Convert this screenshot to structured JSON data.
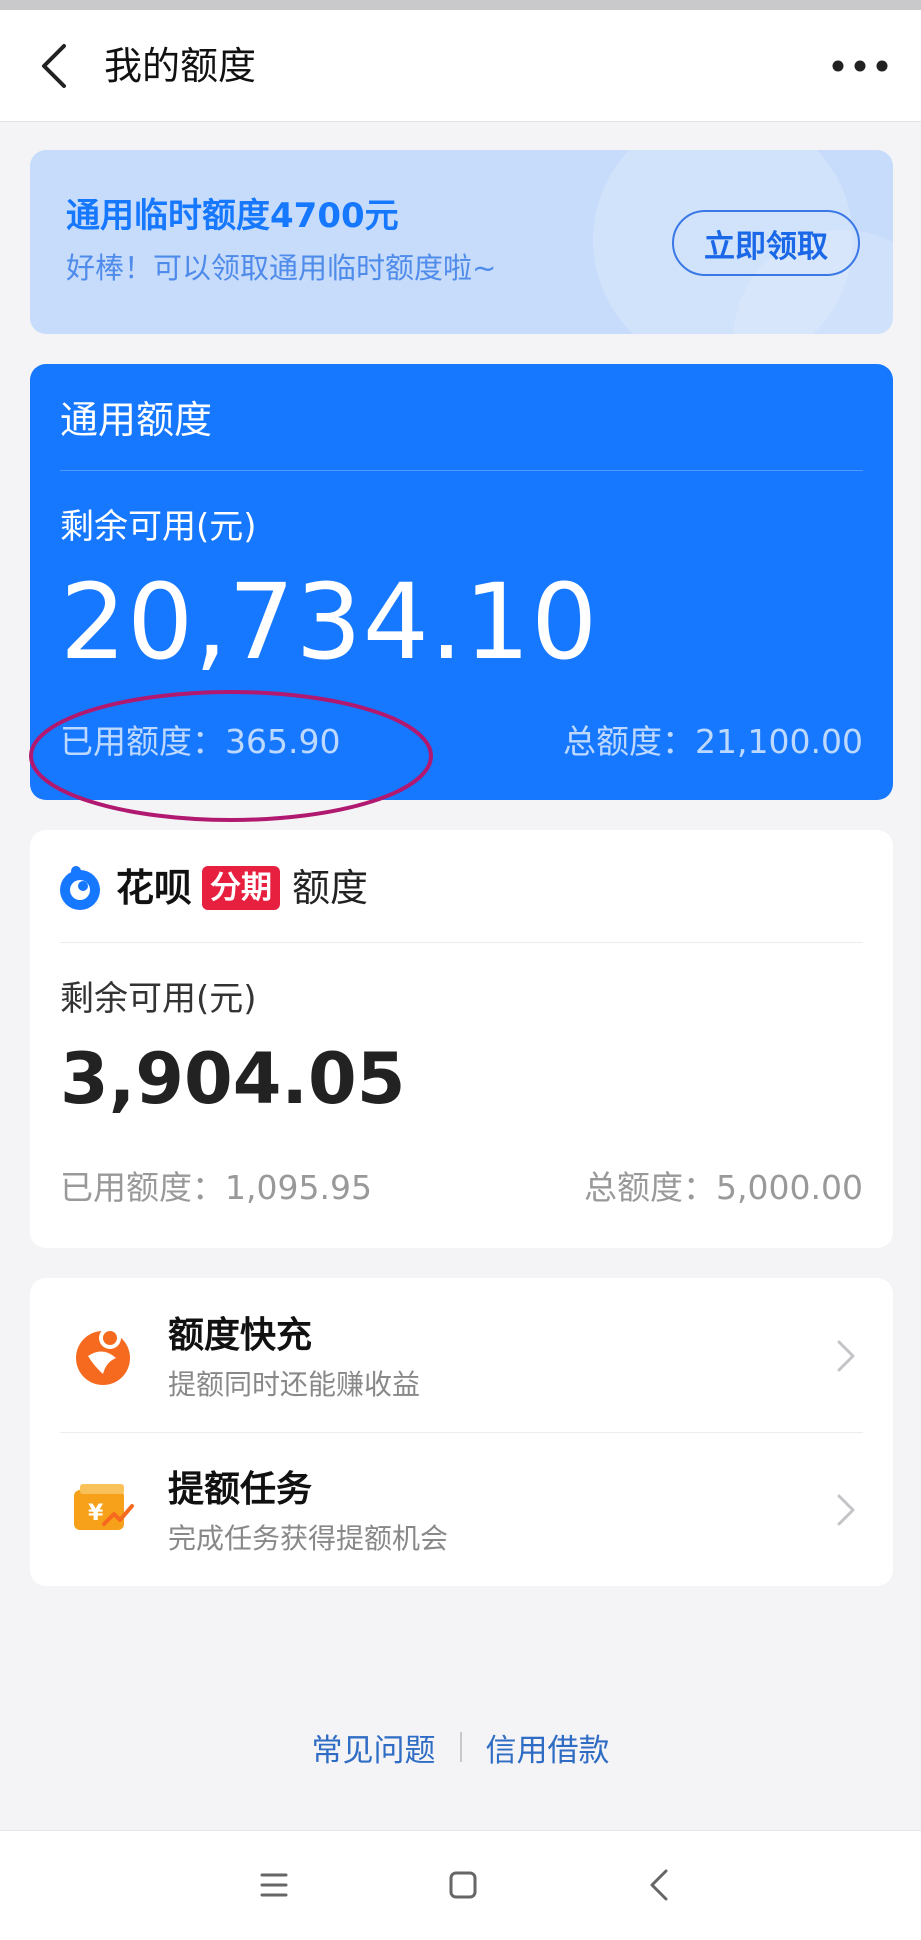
{
  "header": {
    "title": "我的额度",
    "back_icon": "chevron-left-icon",
    "more_icon": "more-dots-icon"
  },
  "promo": {
    "title": "通用临时额度4700元",
    "subtitle": "好棒！可以领取通用临时额度啦~",
    "button_label": "立即领取"
  },
  "general_quota": {
    "title": "通用额度",
    "available_label": "剩余可用(元)",
    "available_amount": "20,734.10",
    "used_text": "已用额度：365.90",
    "total_text": "总额度：21,100.00"
  },
  "huabei_quota": {
    "brand": "花呗",
    "tag": "分期",
    "suffix": "额度",
    "available_label": "剩余可用(元)",
    "available_amount": "3,904.05",
    "used_text": "已用额度：1,095.95",
    "total_text": "总额度：5,000.00"
  },
  "services": [
    {
      "title": "额度快充",
      "subtitle": "提额同时还能赚收益",
      "icon": "quota-charge-icon"
    },
    {
      "title": "提额任务",
      "subtitle": "完成任务获得提额机会",
      "icon": "quota-task-icon"
    }
  ],
  "footer": {
    "faq": "常见问题",
    "credit_loan": "信用借款"
  },
  "colors": {
    "primary_blue": "#1677ff",
    "promo_bg": "#c7dcfb",
    "tag_red": "#e8203f",
    "annotation_circle": "#b0196f",
    "service_orange": "#f56a1e"
  }
}
